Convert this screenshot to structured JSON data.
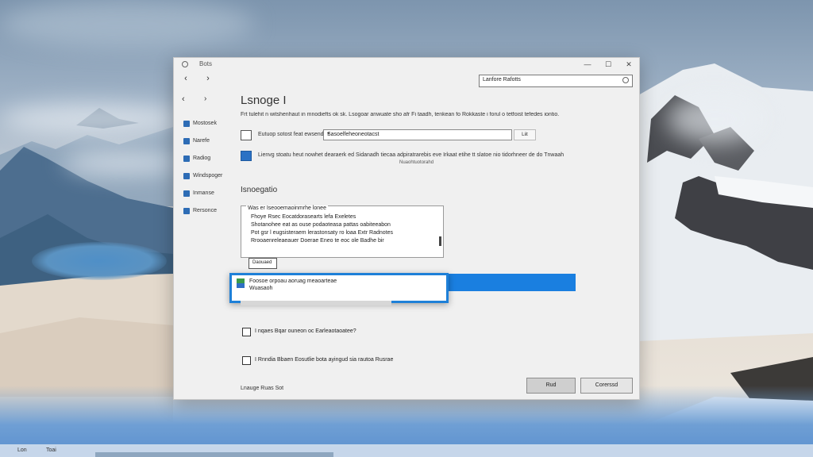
{
  "window": {
    "title": "Bots",
    "search_value": "Lanfore Rafotts"
  },
  "nav": {
    "back": "‹",
    "forward": "›"
  },
  "controls": {
    "minimize": "—",
    "maximize": "☐",
    "close": "✕"
  },
  "sidebar": {
    "back_glyph": "‹",
    "forward_glyph": "›",
    "items": [
      {
        "label": "Mostosek"
      },
      {
        "label": "Narefe"
      },
      {
        "label": "Radiog"
      },
      {
        "label": "Windspoger"
      },
      {
        "label": "Inmanse"
      },
      {
        "label": "Rersonce"
      }
    ]
  },
  "main": {
    "title": "Lsnoge I",
    "description": "Frt tulehit n witshenhaut in mnodiefts ok sk. Lsogoar anwuate sho afr Fi taadh, tenkean fo Rokkaste i forul o tetfoist tefedes iontio.",
    "options": [
      {
        "label": "Eutuop sotost feat ewsend",
        "field_value": "Sasoelfeheoneotacst",
        "button_label": "Liit"
      },
      {
        "label": "Lienvg stoatu heut nowhet dearaerk ed Sidanadh tiecaa adpiratrarebis eve Irkaat etihe tt slatoe nio tidorhneer de do Tnwaah",
        "sub_label": "Nuaohtuotorahd"
      }
    ],
    "section_title": "Isnoegatio",
    "list": {
      "header": "Was er Iseooemaoinmrhe lonee",
      "lines": [
        "Fhoye Rsec Eocatdorasearts lefa Exeletes",
        "Shotanohee eat as ouse podaoteasa pattas oabiteeabon",
        "Pot gsr l eugsisteraem lerastonsaty ro loaa Extr Radnotes",
        "Rrooaenreleaeauer Doerae Eneo te eoc ole Badhe bir"
      ]
    },
    "small_input": "Daouaed",
    "popup": {
      "line1": "Foosoe orpoau aoruag meaoarteae",
      "line2": "Wuasaoh"
    },
    "checks": [
      {
        "label": "I nqaes Bqar ouneon oc Earleaotaoatee?"
      },
      {
        "label": "I Rnndia Bbaen Eosutlie bota ayingud sia rautoa Rusrae"
      }
    ],
    "footer_text": "Lnauge Ruas Sot",
    "ok_label": "Rud",
    "cancel_label": "Corerssd"
  },
  "taskbar": {
    "item1": "Lon",
    "item2": "Toai"
  },
  "colors": {
    "accent": "#1a7fe0",
    "window_bg": "#f0f0f0",
    "icon_blue": "#2d6cb5"
  }
}
